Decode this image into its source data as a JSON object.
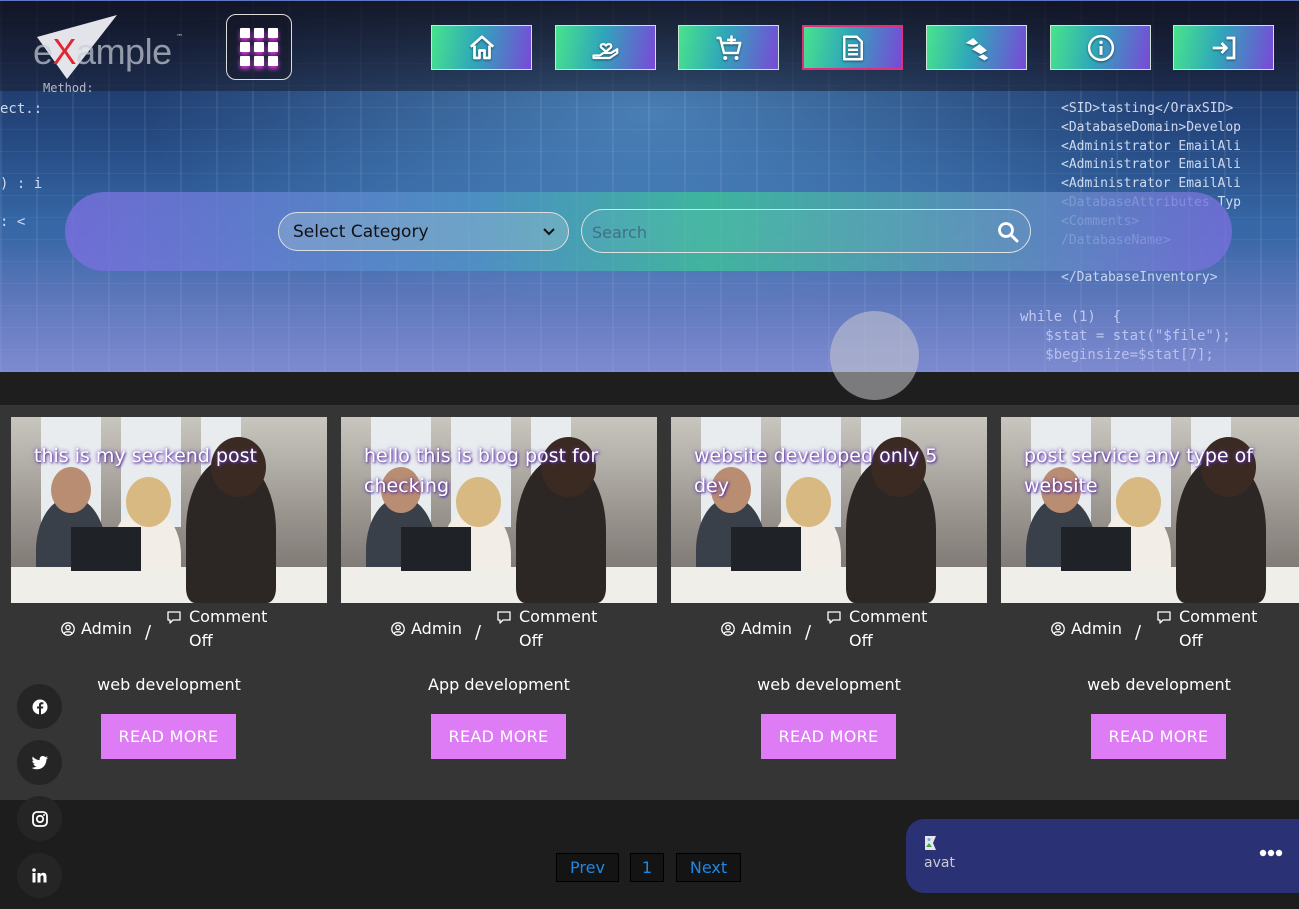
{
  "header": {
    "logo": {
      "prefix": "e",
      "x": "X",
      "suffix": "ample",
      "tm": "™"
    },
    "logo_subtext": "Method:",
    "nav": [
      {
        "name": "home",
        "icon": "home-icon"
      },
      {
        "name": "donate",
        "icon": "hand-heart-icon"
      },
      {
        "name": "add-to-cart",
        "icon": "cart-plus-icon"
      },
      {
        "name": "blog",
        "icon": "document-icon",
        "active": true
      },
      {
        "name": "services",
        "icon": "service-icon"
      },
      {
        "name": "about",
        "icon": "info-icon"
      },
      {
        "name": "login",
        "icon": "sign-in-icon"
      }
    ]
  },
  "hero": {
    "code_right": [
      "<SID>tasting</OraxSID>",
      "<DatabaseDomain>Develop",
      "<Administrator EmailAli",
      "<Administrator EmailAli",
      "<Administrator EmailAli",
      "<DatabaseAttributes Typ",
      "<Comments>",
      "/DatabaseName>",
      "",
      "</DatabaseInventory>"
    ],
    "code_left": [
      "ect.:",
      "",
      "",
      "",
      ") : i",
      "",
      ": <"
    ],
    "code_bottom": [
      "while (1)  {",
      "   $stat = stat(\"$file\");",
      "   $beginsize=$stat[7];"
    ]
  },
  "search": {
    "category_label": "Select Category",
    "placeholder": "Search"
  },
  "posts": [
    {
      "title": "this is my seckend post",
      "author": "Admin",
      "comment": "Comment Off",
      "category": "web development",
      "button": "READ MORE"
    },
    {
      "title": "hello this is blog post for checking",
      "author": "Admin",
      "comment": "Comment Off",
      "category": "App development",
      "button": "READ MORE"
    },
    {
      "title": "website developed only 5 dey",
      "author": "Admin",
      "comment": "Comment Off",
      "category": "web development",
      "button": "READ MORE"
    },
    {
      "title": "post service any type of website",
      "author": "Admin",
      "comment": "Comment Off",
      "category": "web development",
      "button": "READ MORE"
    }
  ],
  "pagination": {
    "prev": "Prev",
    "page": "1",
    "next": "Next"
  },
  "social": [
    "facebook-icon",
    "twitter-icon",
    "instagram-icon",
    "linkedin-icon"
  ],
  "chat": {
    "avatar_alt": "avat",
    "more": "•••"
  },
  "colors": {
    "accent": "#dd7cf5",
    "nav_gradient_start": "#48e38d",
    "nav_gradient_end": "#7a48d8",
    "active_border": "#e0307b",
    "pagination_link": "#1e88e5",
    "chat_bg": "#2b3175"
  }
}
